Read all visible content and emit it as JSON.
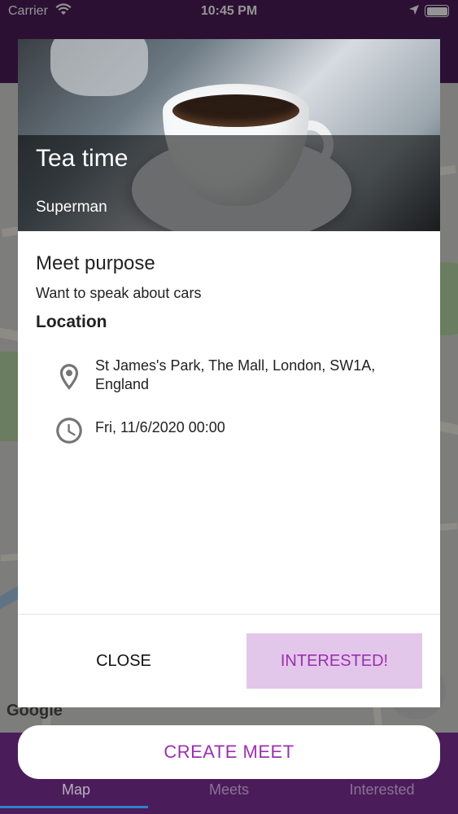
{
  "status_bar": {
    "carrier": "Carrier",
    "time": "10:45 PM"
  },
  "map": {
    "logo_text": "Google"
  },
  "dialog": {
    "title": "Tea time",
    "subtitle": "Superman",
    "purpose_heading": "Meet purpose",
    "purpose_text": "Want to speak about cars",
    "location_heading": "Location",
    "address": "St James's Park, The Mall, London, SW1A, England",
    "datetime": "Fri, 11/6/2020 00:00",
    "close_label": "CLOSE",
    "interested_label": "INTERESTED!"
  },
  "create_meet_label": "CREATE MEET",
  "bottom_nav": {
    "items": [
      {
        "label": "Map"
      },
      {
        "label": "Meets"
      },
      {
        "label": "Interested"
      }
    ]
  },
  "colors": {
    "primary": "#4a1d5a",
    "accent": "#9c2fb0",
    "accent_light": "#e3c7ea"
  },
  "icons": {
    "address": "map-pin-icon",
    "datetime": "clock-icon"
  }
}
